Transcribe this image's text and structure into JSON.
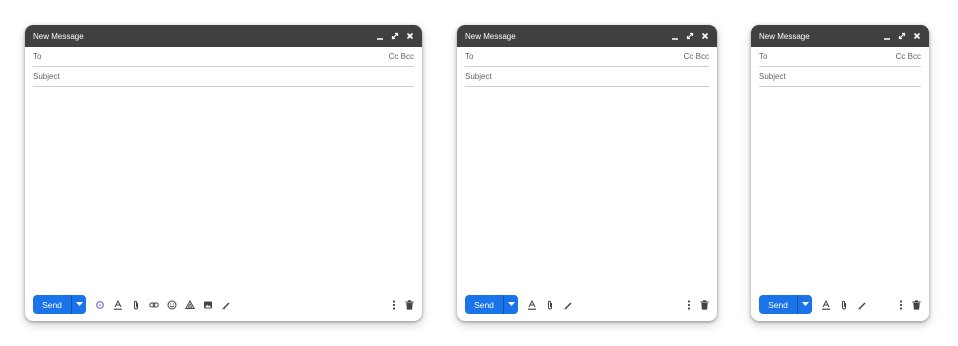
{
  "windows": [
    {
      "title": "New Message",
      "to_label": "To",
      "cc_bcc": "Cc Bcc",
      "subject_placeholder": "Subject",
      "send_label": "Send",
      "tools": [
        "ai-assist-icon",
        "text-format-icon",
        "attach-icon",
        "link-icon",
        "emoji-icon",
        "drive-icon",
        "photo-icon",
        "signature-icon"
      ]
    },
    {
      "title": "New Message",
      "to_label": "To",
      "cc_bcc": "Cc Bcc",
      "subject_placeholder": "Subject",
      "send_label": "Send",
      "tools": [
        "text-format-icon",
        "attach-icon",
        "signature-icon"
      ]
    },
    {
      "title": "New Message",
      "to_label": "To",
      "cc_bcc": "Cc Bcc",
      "subject_placeholder": "Subject",
      "send_label": "Send",
      "tools": [
        "text-format-icon",
        "attach-icon",
        "signature-icon"
      ]
    }
  ],
  "colors": {
    "titlebar": "#404040",
    "send": "#1a73e8",
    "ai": "#8a7cf0"
  }
}
